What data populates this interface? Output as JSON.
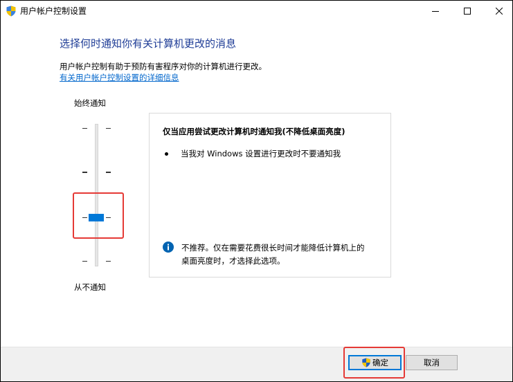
{
  "window": {
    "title": "用户帐户控制设置"
  },
  "main": {
    "heading": "选择何时通知你有关计算机更改的消息",
    "description": "用户帐户控制有助于预防有害程序对你的计算机进行更改。",
    "link": "有关用户帐户控制设置的详细信息"
  },
  "slider": {
    "top_label": "始终通知",
    "bottom_label": "从不通知",
    "levels": 4,
    "selected_level": 2,
    "accent_color": "#0078d7"
  },
  "info": {
    "title": "仅当应用尝试更改计算机时通知我(不降低桌面亮度)",
    "bullet": "当我对 Windows 设置进行更改时不要通知我",
    "note_line1": "不推荐。仅在需要花费很长时间才能降低计算机上的",
    "note_line2": "桌面亮度时，才选择此选项。"
  },
  "buttons": {
    "ok": "确定",
    "cancel": "取消"
  },
  "colors": {
    "heading": "#1e3c96",
    "link": "#0066cc",
    "highlight": "#e53935"
  }
}
